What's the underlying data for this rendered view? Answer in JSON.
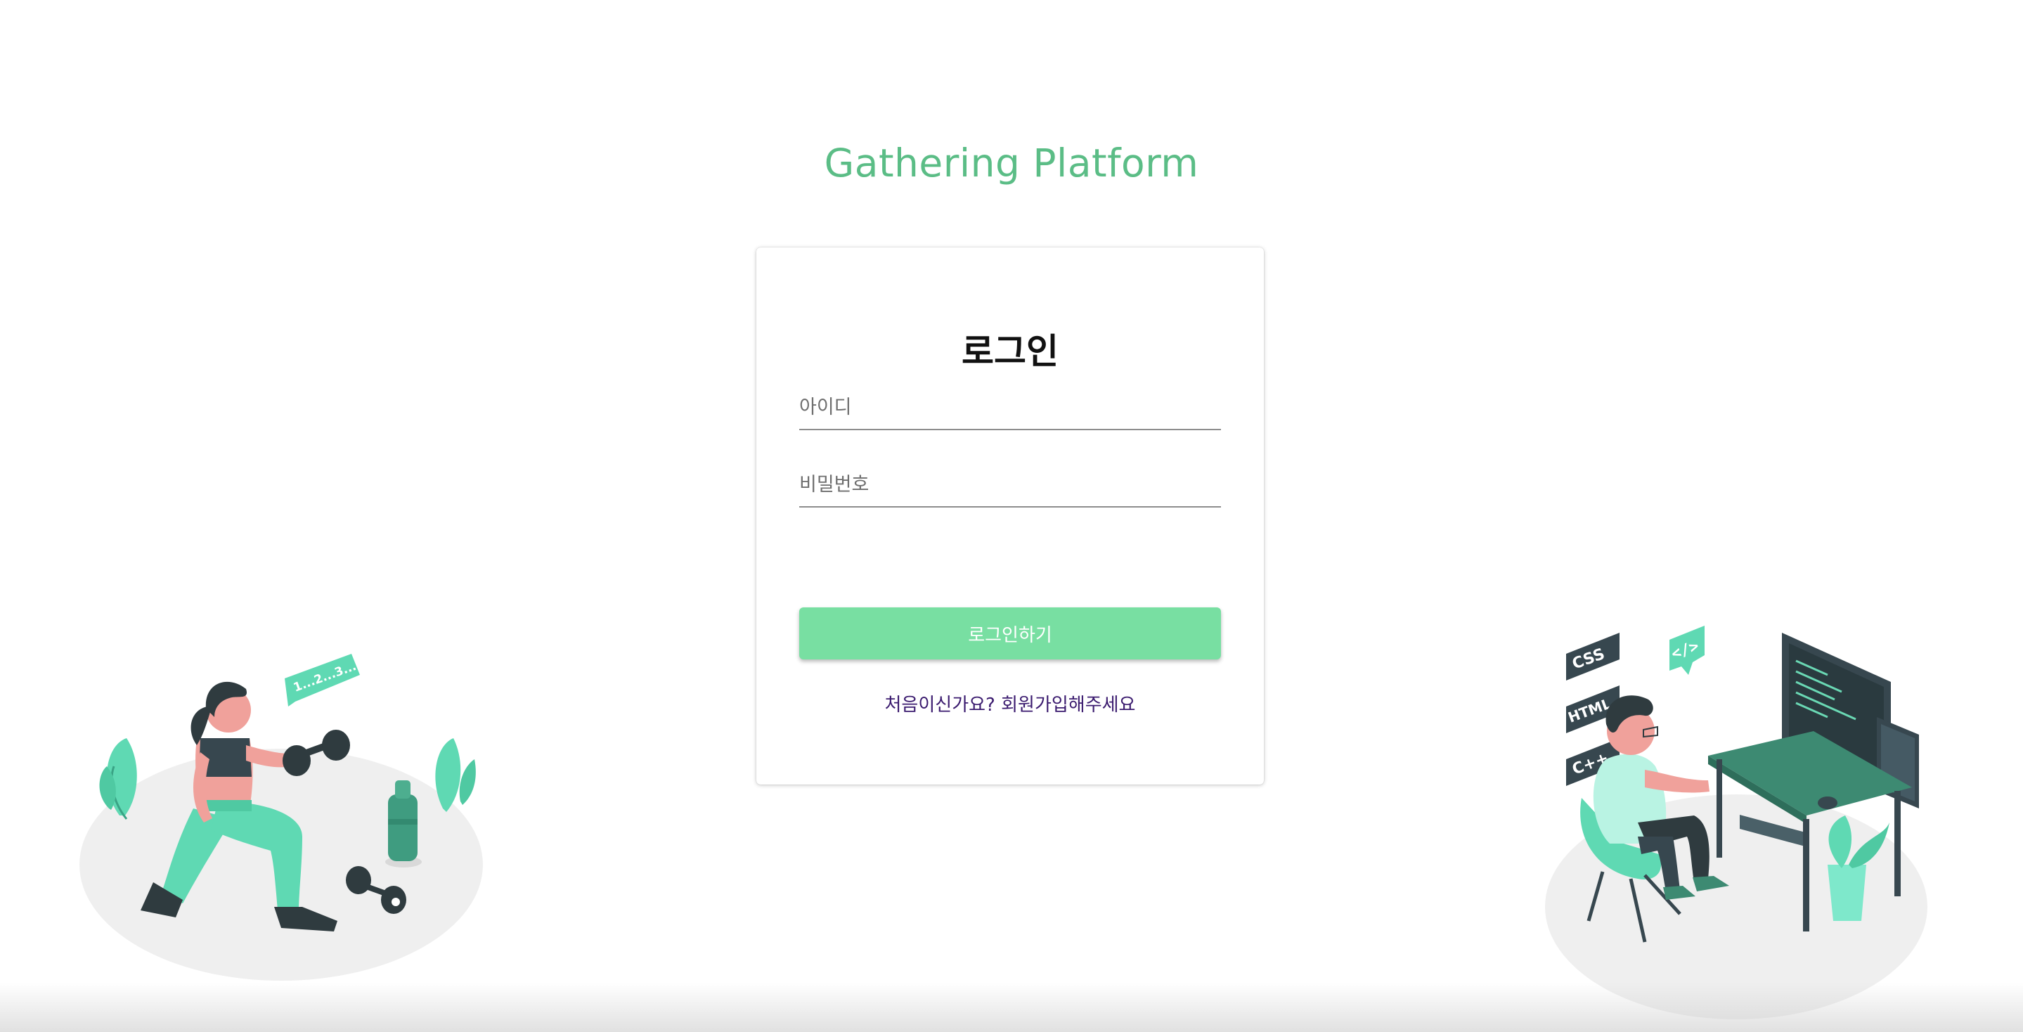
{
  "app": {
    "title": "Gathering Platform"
  },
  "login": {
    "heading": "로그인",
    "id_placeholder": "아이디",
    "id_value": "",
    "password_placeholder": "비밀번호",
    "password_value": "",
    "submit_label": "로그인하기",
    "signup_link": "처음이신가요? 회원가입해주세요"
  },
  "illustrations": {
    "left_counter_bubble": "1...2...3...",
    "right_tags": [
      "CSS",
      "HTML",
      "C++"
    ],
    "right_code_bubble": "</>"
  },
  "colors": {
    "brand": "#5bbd86",
    "button": "#78dfa2",
    "link": "#3a1a6e",
    "illustration_teal": "#5fd9b3",
    "illustration_dark": "#2f3b3f"
  }
}
